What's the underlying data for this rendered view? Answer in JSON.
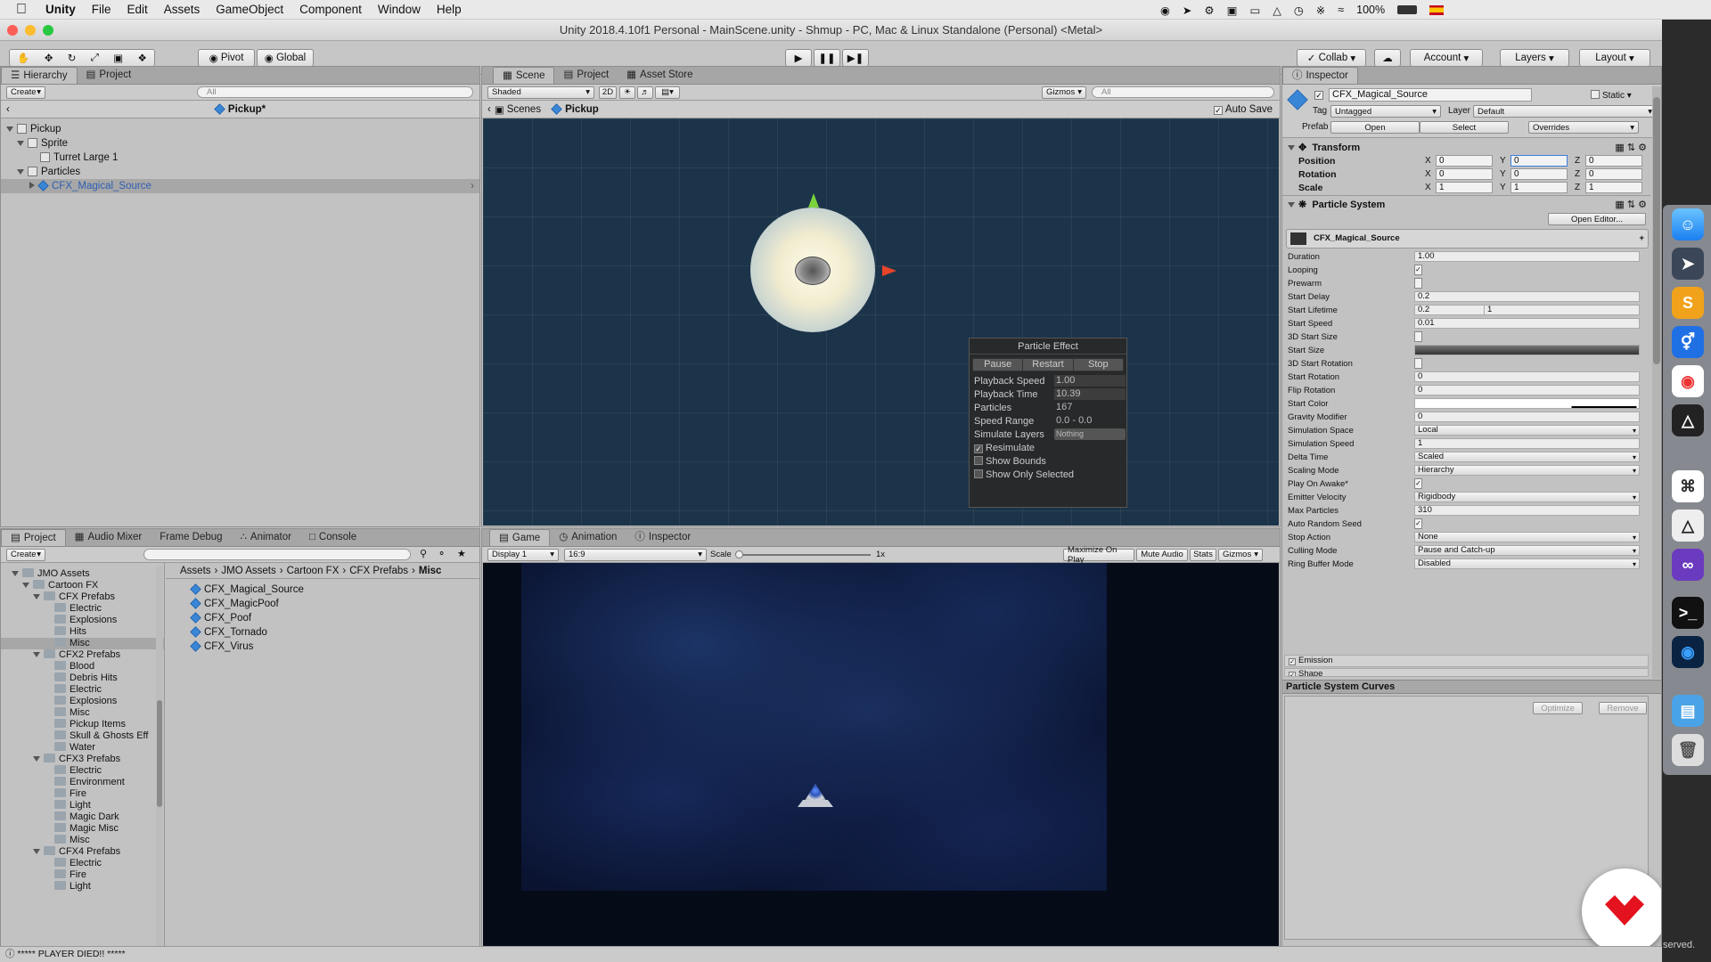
{
  "menubar": {
    "app": "Unity",
    "items": [
      "File",
      "Edit",
      "Assets",
      "GameObject",
      "Component",
      "Window",
      "Help"
    ],
    "battery": "100%"
  },
  "window": {
    "title": "Unity 2018.4.10f1 Personal - MainScene.unity - Shmup - PC, Mac & Linux Standalone (Personal) <Metal>"
  },
  "toolbar": {
    "pivot": "Pivot",
    "global": "Global",
    "collab": "Collab",
    "account": "Account",
    "layers": "Layers",
    "layout": "Layout"
  },
  "hierarchy": {
    "tab": "Hierarchy",
    "tab2": "Project",
    "create": "Create",
    "search_placeholder": "All",
    "header": "Pickup*",
    "items": [
      "Pickup",
      "Sprite",
      "Turret Large 1",
      "Particles",
      "CFX_Magical_Source"
    ]
  },
  "scene": {
    "tabs": [
      "Scene",
      "Project",
      "Asset Store"
    ],
    "shading": "Shaded",
    "mode_2d": "2D",
    "gizmos": "Gizmos",
    "search_placeholder": "All",
    "breadcrumb_scenes": "Scenes",
    "breadcrumb_prefab": "Pickup",
    "auto_save": "Auto Save"
  },
  "particle_effect": {
    "title": "Particle Effect",
    "pause": "Pause",
    "restart": "Restart",
    "stop": "Stop",
    "rows": [
      {
        "label": "Playback Speed",
        "value": "1.00"
      },
      {
        "label": "Playback Time",
        "value": "10.39"
      },
      {
        "label": "Particles",
        "value": "167"
      },
      {
        "label": "Speed Range",
        "value": "0.0 - 0.0"
      },
      {
        "label": "Simulate Layers",
        "value": "Nothing"
      }
    ],
    "resimulate": "Resimulate",
    "show_bounds": "Show Bounds",
    "show_only_selected": "Show Only Selected"
  },
  "project": {
    "tabs": [
      "Project",
      "Audio Mixer",
      "Frame Debug",
      "Animator",
      "Console"
    ],
    "create": "Create",
    "tree": [
      {
        "label": "JMO Assets",
        "level": 1,
        "open": true
      },
      {
        "label": "Cartoon FX",
        "level": 2,
        "open": true
      },
      {
        "label": "CFX Prefabs",
        "level": 3,
        "open": true
      },
      {
        "label": "Electric",
        "level": 4
      },
      {
        "label": "Explosions",
        "level": 4
      },
      {
        "label": "Hits",
        "level": 4
      },
      {
        "label": "Misc",
        "level": 4,
        "selected": true
      },
      {
        "label": "CFX2 Prefabs",
        "level": 3,
        "open": true
      },
      {
        "label": "Blood",
        "level": 4
      },
      {
        "label": "Debris Hits",
        "level": 4
      },
      {
        "label": "Electric",
        "level": 4
      },
      {
        "label": "Explosions",
        "level": 4
      },
      {
        "label": "Misc",
        "level": 4
      },
      {
        "label": "Pickup Items",
        "level": 4
      },
      {
        "label": "Skull & Ghosts Eff",
        "level": 4
      },
      {
        "label": "Water",
        "level": 4
      },
      {
        "label": "CFX3 Prefabs",
        "level": 3,
        "open": true
      },
      {
        "label": "Electric",
        "level": 4
      },
      {
        "label": "Environment",
        "level": 4
      },
      {
        "label": "Fire",
        "level": 4
      },
      {
        "label": "Light",
        "level": 4
      },
      {
        "label": "Magic Dark",
        "level": 4
      },
      {
        "label": "Magic Misc",
        "level": 4
      },
      {
        "label": "Misc",
        "level": 4
      },
      {
        "label": "CFX4 Prefabs",
        "level": 3,
        "open": true
      },
      {
        "label": "Electric",
        "level": 4
      },
      {
        "label": "Fire",
        "level": 4
      },
      {
        "label": "Light",
        "level": 4
      }
    ],
    "breadcrumb": [
      "Assets",
      "JMO Assets",
      "Cartoon FX",
      "CFX Prefabs",
      "Misc"
    ],
    "files": [
      "CFX_Magical_Source",
      "CFX_MagicPoof",
      "CFX_Poof",
      "CFX_Tornado",
      "CFX_Virus"
    ]
  },
  "game": {
    "tabs": [
      "Game",
      "Animation",
      "Inspector"
    ],
    "display": "Display 1",
    "aspect": "16:9",
    "scale_label": "Scale",
    "scale_value": "1x",
    "maximize": "Maximize On Play",
    "mute": "Mute Audio",
    "stats": "Stats",
    "gizmos": "Gizmos"
  },
  "inspector": {
    "tab": "Inspector",
    "object_name": "CFX_Magical_Source",
    "static": "Static",
    "tag_label": "Tag",
    "tag": "Untagged",
    "layer_label": "Layer",
    "layer": "Default",
    "prefab_label": "Prefab",
    "open": "Open",
    "select": "Select",
    "overrides": "Overrides",
    "transform": "Transform",
    "position_label": "Position",
    "rotation_label": "Rotation",
    "scale_label": "Scale",
    "position": {
      "x": "0",
      "y": "0",
      "z": "0"
    },
    "rotation": {
      "x": "0",
      "y": "0",
      "z": "0"
    },
    "scale": {
      "x": "1",
      "y": "1",
      "z": "1"
    },
    "particle_system": "Particle System",
    "open_editor": "Open Editor...",
    "module_title": "CFX_Magical_Source",
    "props": [
      {
        "k": "Duration",
        "v": "1.00"
      },
      {
        "k": "Looping",
        "v": "✓",
        "type": "check"
      },
      {
        "k": "Prewarm",
        "v": "",
        "type": "check"
      },
      {
        "k": "Start Delay",
        "v": "0.2"
      },
      {
        "k": "Start Lifetime",
        "v": "0.2",
        "v2": "1"
      },
      {
        "k": "Start Speed",
        "v": "0.01"
      },
      {
        "k": "3D Start Size",
        "v": "",
        "type": "check"
      },
      {
        "k": "Start Size",
        "v": "",
        "type": "curve"
      },
      {
        "k": "3D Start Rotation",
        "v": "",
        "type": "check"
      },
      {
        "k": "Start Rotation",
        "v": "0"
      },
      {
        "k": "Flip Rotation",
        "v": "0"
      },
      {
        "k": "Start Color",
        "v": "",
        "type": "color"
      },
      {
        "k": "Gravity Modifier",
        "v": "0"
      },
      {
        "k": "Simulation Space",
        "v": "Local",
        "type": "dd"
      },
      {
        "k": "Simulation Speed",
        "v": "1"
      },
      {
        "k": "Delta Time",
        "v": "Scaled",
        "type": "dd"
      },
      {
        "k": "Scaling Mode",
        "v": "Hierarchy",
        "type": "dd"
      },
      {
        "k": "Play On Awake*",
        "v": "✓",
        "type": "check"
      },
      {
        "k": "Emitter Velocity",
        "v": "Rigidbody",
        "type": "dd"
      },
      {
        "k": "Max Particles",
        "v": "310"
      },
      {
        "k": "Auto Random Seed",
        "v": "✓",
        "type": "check"
      },
      {
        "k": "Stop Action",
        "v": "None",
        "type": "dd"
      },
      {
        "k": "Culling Mode",
        "v": "Pause and Catch-up",
        "type": "dd"
      },
      {
        "k": "Ring Buffer Mode",
        "v": "Disabled",
        "type": "dd"
      }
    ],
    "emission": "Emission",
    "shape": "Shape",
    "curves_title": "Particle System Curves",
    "optimize": "Optimize",
    "remove": "Remove"
  },
  "status": {
    "message": "***** PLAYER DIED!! *****",
    "right": "served."
  }
}
